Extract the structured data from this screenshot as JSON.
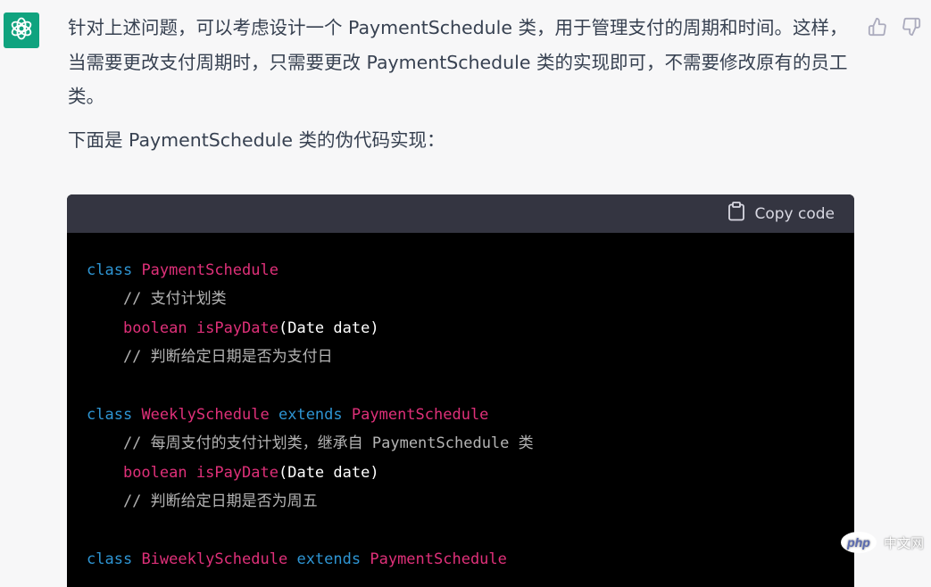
{
  "message": {
    "paragraph1": "针对上述问题，可以考虑设计一个 PaymentSchedule 类，用于管理支付的周期和时间。这样，当需要更改支付周期时，只需要更改 PaymentSchedule 类的实现即可，不需要修改原有的员工类。",
    "paragraph2": "下面是 PaymentSchedule 类的伪代码实现："
  },
  "avatar": {
    "icon": "openai-logo-icon",
    "color": "#10a37f"
  },
  "feedback": {
    "like_icon": "thumbs-up-icon",
    "dislike_icon": "thumbs-down-icon"
  },
  "code_block": {
    "copy_label": "Copy code",
    "copy_icon": "clipboard-icon",
    "lines": [
      [
        {
          "t": "class",
          "c": "kw"
        },
        {
          "t": " ",
          "c": "plain"
        },
        {
          "t": "PaymentSchedule",
          "c": "cls"
        }
      ],
      [
        {
          "t": "    // 支付计划类",
          "c": "cmt"
        }
      ],
      [
        {
          "t": "    ",
          "c": "plain"
        },
        {
          "t": "boolean",
          "c": "type"
        },
        {
          "t": " ",
          "c": "plain"
        },
        {
          "t": "isPayDate",
          "c": "fn"
        },
        {
          "t": "(Date date)",
          "c": "plain"
        }
      ],
      [
        {
          "t": "    // 判断给定日期是否为支付日",
          "c": "cmt"
        }
      ],
      [],
      [
        {
          "t": "class",
          "c": "kw"
        },
        {
          "t": " ",
          "c": "plain"
        },
        {
          "t": "WeeklySchedule",
          "c": "cls"
        },
        {
          "t": " ",
          "c": "plain"
        },
        {
          "t": "extends",
          "c": "kw"
        },
        {
          "t": " ",
          "c": "plain"
        },
        {
          "t": "PaymentSchedule",
          "c": "cls"
        }
      ],
      [
        {
          "t": "    // 每周支付的支付计划类，继承自 PaymentSchedule 类",
          "c": "cmt"
        }
      ],
      [
        {
          "t": "    ",
          "c": "plain"
        },
        {
          "t": "boolean",
          "c": "type"
        },
        {
          "t": " ",
          "c": "plain"
        },
        {
          "t": "isPayDate",
          "c": "fn"
        },
        {
          "t": "(Date date)",
          "c": "plain"
        }
      ],
      [
        {
          "t": "    // 判断给定日期是否为周五",
          "c": "cmt"
        }
      ],
      [],
      [
        {
          "t": "class",
          "c": "kw"
        },
        {
          "t": " ",
          "c": "plain"
        },
        {
          "t": "BiweeklySchedule",
          "c": "cls"
        },
        {
          "t": " ",
          "c": "plain"
        },
        {
          "t": "extends",
          "c": "kw"
        },
        {
          "t": " ",
          "c": "plain"
        },
        {
          "t": "PaymentSchedule",
          "c": "cls"
        }
      ]
    ]
  },
  "watermark": {
    "badge": "php",
    "text": "中文网"
  },
  "colors": {
    "keyword": "#2e95d3",
    "identifier": "#df3079",
    "comment": "#b4b4b4",
    "code_bg": "#000000",
    "code_header_bg": "#343541"
  }
}
